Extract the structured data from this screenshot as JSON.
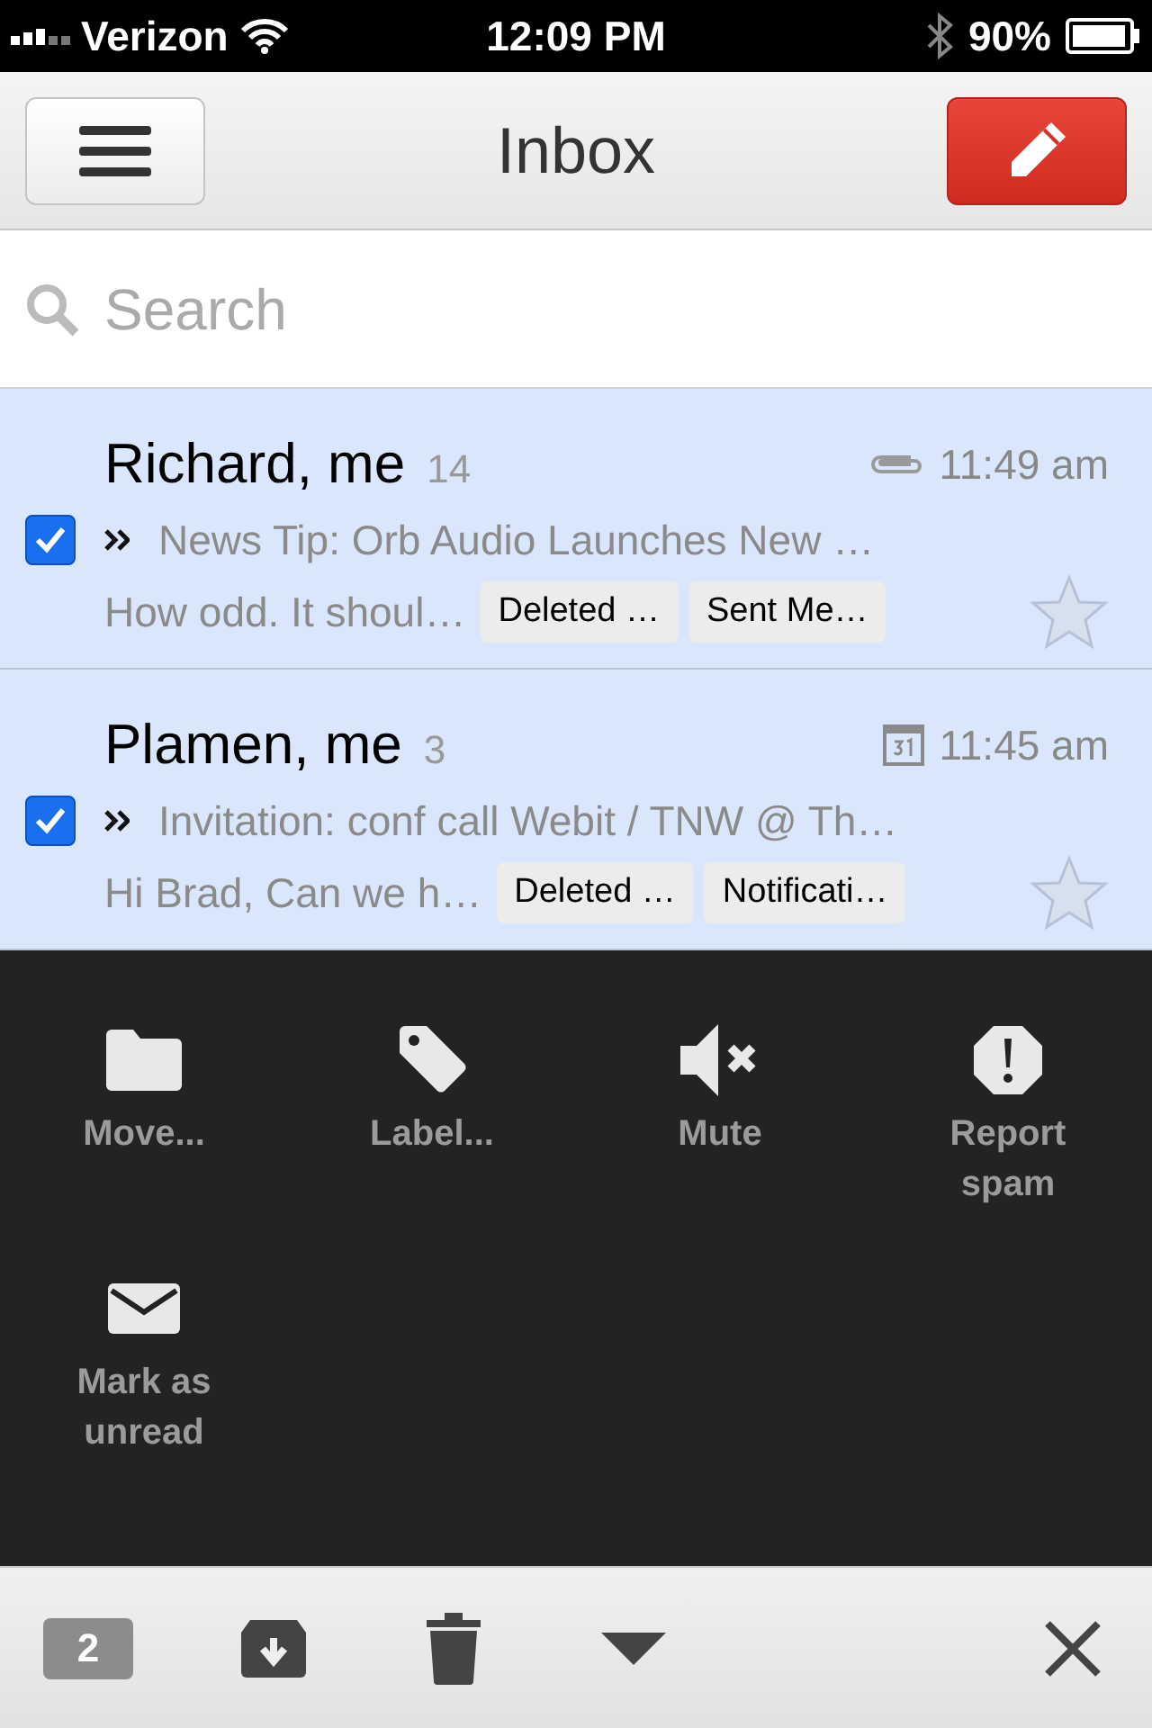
{
  "status_bar": {
    "carrier": "Verizon",
    "time": "12:09 PM",
    "battery": "90%"
  },
  "header": {
    "title": "Inbox"
  },
  "search": {
    "placeholder": "Search"
  },
  "threads": [
    {
      "sender": "Richard, me",
      "count": "14",
      "kind": "attachment",
      "time": "11:49 am",
      "subject": "News Tip: Orb Audio Launches New …",
      "snippet": "How odd. It shoul…",
      "labels": [
        "Deleted …",
        "Sent Me…"
      ],
      "checked": true,
      "starred": false
    },
    {
      "sender": "Plamen, me",
      "count": "3",
      "kind": "calendar",
      "time": "11:45 am",
      "subject": "Invitation: conf call Webit / TNW @ Th…",
      "snippet": "Hi Brad, Can we h…",
      "labels": [
        "Deleted …",
        "Notificati…"
      ],
      "checked": true,
      "starred": false
    }
  ],
  "actions": [
    {
      "kind": "folder",
      "label": "Move..."
    },
    {
      "kind": "tag",
      "label": "Label..."
    },
    {
      "kind": "mute",
      "label": "Mute"
    },
    {
      "kind": "spam",
      "label": "Report spam"
    },
    {
      "kind": "mail",
      "label": "Mark as unread"
    }
  ],
  "bottom_bar": {
    "selected_count": "2"
  }
}
